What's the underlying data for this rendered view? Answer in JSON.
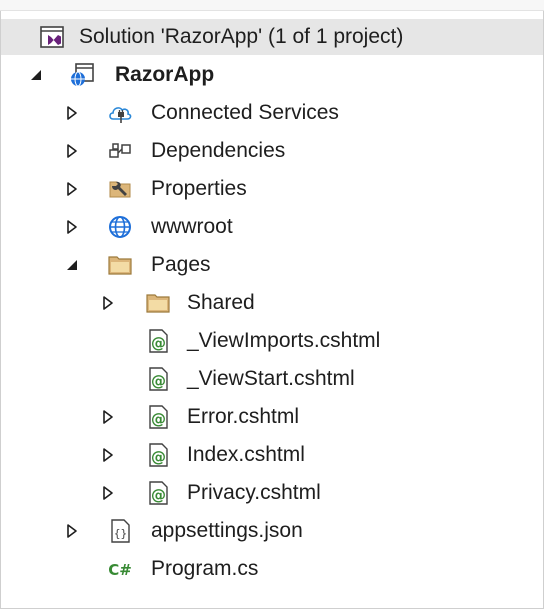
{
  "solution": {
    "label": "Solution 'RazorApp' (1 of 1 project)"
  },
  "project": {
    "label": "RazorApp"
  },
  "nodes": {
    "connected_services": {
      "label": "Connected Services"
    },
    "dependencies": {
      "label": "Dependencies"
    },
    "properties": {
      "label": "Properties"
    },
    "wwwroot": {
      "label": "wwwroot"
    },
    "pages": {
      "label": "Pages"
    },
    "shared": {
      "label": "Shared"
    },
    "view_imports": {
      "label": "_ViewImports.cshtml"
    },
    "view_start": {
      "label": "_ViewStart.cshtml"
    },
    "error": {
      "label": "Error.cshtml"
    },
    "index": {
      "label": "Index.cshtml"
    },
    "privacy": {
      "label": "Privacy.cshtml"
    },
    "appsettings": {
      "label": "appsettings.json"
    },
    "program": {
      "label": "Program.cs"
    }
  },
  "icons": {
    "razor_glyph": "@",
    "json_glyph": "{}",
    "csharp_glyph": "C#"
  },
  "colors": {
    "selection": "#e6e6e6",
    "folder": "#dcb67a",
    "razor_green": "#388a34",
    "csharp_green": "#388a34",
    "globe_blue": "#1e6fd9",
    "vs_purple": "#68217a"
  }
}
